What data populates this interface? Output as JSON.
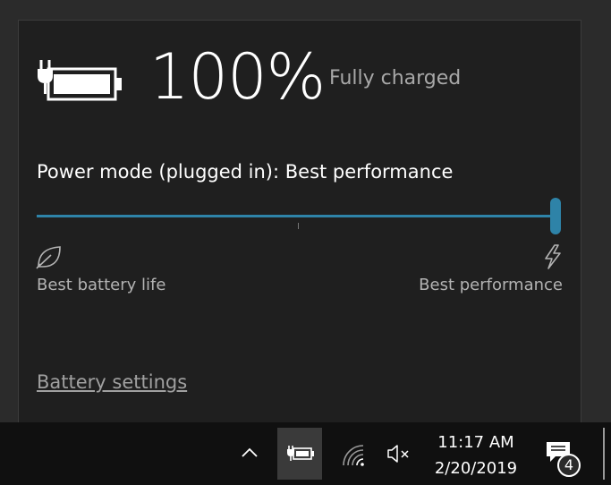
{
  "battery": {
    "percent": "100%",
    "status": "Fully charged",
    "level": 1.0
  },
  "power_mode": {
    "title": "Power mode (plugged in): Best performance",
    "slider_value_fraction": 1.0,
    "left_label": "Best battery life",
    "right_label": "Best performance",
    "accent_color": "#2e83a8"
  },
  "settings_link": "Battery settings",
  "taskbar": {
    "time": "11:17 AM",
    "date": "2/20/2019",
    "notification_count": "4",
    "icons": [
      "chevron-up-icon",
      "battery-plugged-icon",
      "wifi-icon",
      "volume-muted-icon",
      "action-center-icon"
    ]
  }
}
